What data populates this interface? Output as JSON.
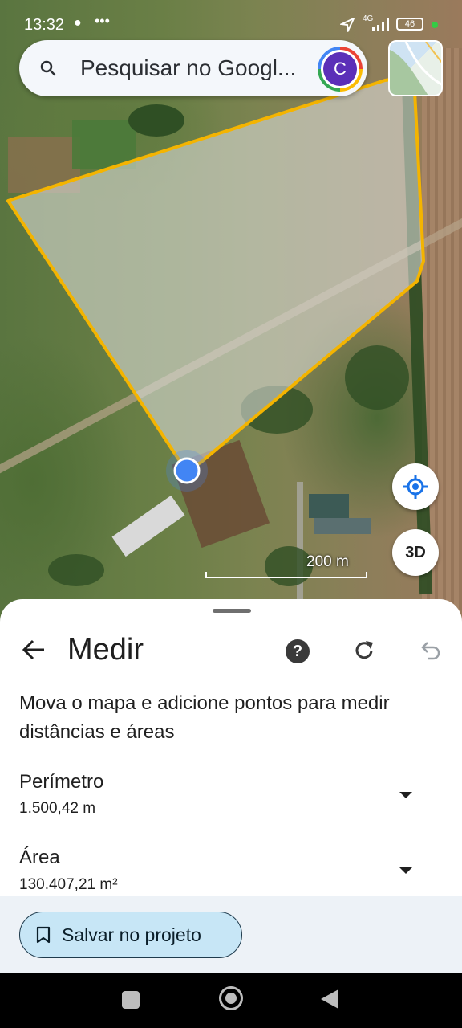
{
  "status_bar": {
    "time": "13:32",
    "network": "4G",
    "battery": "46"
  },
  "search": {
    "placeholder": "Pesquisar no Googl...",
    "avatar_letter": "C"
  },
  "map": {
    "scale_label": "200 m",
    "three_d_label": "3D",
    "polygon_color": "#f4b400",
    "marker_color": "#4285f4"
  },
  "measure": {
    "title": "Medir",
    "help_label": "?",
    "instructions": "Mova o mapa e adicione pontos para medir distâncias e áreas",
    "perimeter": {
      "label": "Perímetro",
      "value": "1.500,42 m"
    },
    "area": {
      "label": "Área",
      "value": "130.407,21 m²"
    },
    "save_button": "Salvar no projeto"
  },
  "colors": {
    "accent": "#c7e6f6",
    "avatar_bg": "#5b2fb8"
  },
  "icons": [
    "search-icon",
    "back-arrow-icon",
    "help-icon",
    "redo-icon",
    "undo-icon",
    "my-location-icon",
    "bookmark-icon"
  ]
}
